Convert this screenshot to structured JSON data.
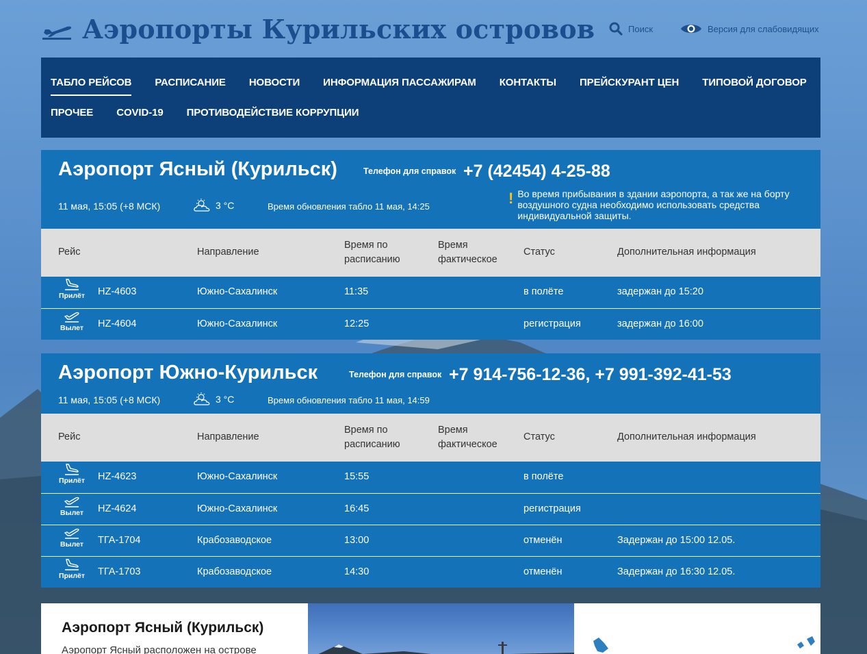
{
  "header": {
    "title": "Аэропорты Курильских островов",
    "search_label": "Поиск",
    "vision_label": "Версия для слабовидящих"
  },
  "nav": {
    "row1": [
      "ТАБЛО РЕЙСОВ",
      "РАСПИСАНИЕ",
      "НОВОСТИ",
      "ИНФОРМАЦИЯ ПАССАЖИРАМ",
      "КОНТАКТЫ",
      "ПРЕЙСКУРАНТ ЦЕН",
      "ТИПОВОЙ ДОГОВОР"
    ],
    "row2": [
      "ПРОЧЕЕ",
      "COVID-19",
      "ПРОТИВОДЕЙСТВИЕ КОРРУПЦИИ"
    ],
    "active": "ТАБЛО РЕЙСОВ"
  },
  "columns": {
    "flight": "Рейс",
    "direction": "Направление",
    "scheduled_1": "Время по",
    "scheduled_2": "расписанию",
    "actual_1": "Время",
    "actual_2": "фактическое",
    "status": "Статус",
    "info": "Дополнительная информация"
  },
  "airports": [
    {
      "name": "Аэропорт Ясный (Курильск)",
      "phone_label": "Телефон для справок",
      "phone": "+7 (42454) 4-25-88",
      "date": "11 мая, 15:05 (+8 МСК)",
      "temp": "3 °C",
      "updated": "Время обновления табло 11 мая, 14:25",
      "notice": "Во время прибывания в здании аэропорта, а так же на борту воздушного судна необходимо использовать средства индивидуальной защиты.",
      "flights": [
        {
          "type": "Прилёт",
          "kind": "arrival",
          "flight": "HZ-4603",
          "direction": "Южно-Сахалинск",
          "scheduled": "11:35",
          "actual": "",
          "status": "в полёте",
          "info": "задержан до 15:20"
        },
        {
          "type": "Вылет",
          "kind": "departure",
          "flight": "HZ-4604",
          "direction": "Южно-Сахалинск",
          "scheduled": "12:25",
          "actual": "",
          "status": "регистрация",
          "info": "задержан до 16:00"
        }
      ]
    },
    {
      "name": "Аэропорт Южно-Курильск",
      "phone_label": "Телефон для справок",
      "phone": "+7 914-756-12-36, +7 991-392-41-53",
      "date": "11 мая, 15:05 (+8 МСК)",
      "temp": "3 °C",
      "updated": "Время обновления табло 11 мая, 14:59",
      "flights": [
        {
          "type": "Прилёт",
          "kind": "arrival",
          "flight": "HZ-4623",
          "direction": "Южно-Сахалинск",
          "scheduled": "15:55",
          "actual": "",
          "status": "в полёте",
          "info": ""
        },
        {
          "type": "Вылет",
          "kind": "departure",
          "flight": "HZ-4624",
          "direction": "Южно-Сахалинск",
          "scheduled": "16:45",
          "actual": "",
          "status": "регистрация",
          "info": ""
        },
        {
          "type": "Вылет",
          "kind": "departure",
          "flight": "ТГА-1704",
          "direction": "Крабозаводское",
          "scheduled": "13:00",
          "actual": "",
          "status": "отменён",
          "info": "Задержан до 15:00 12.05."
        },
        {
          "type": "Прилёт",
          "kind": "arrival",
          "flight": "ТГА-1703",
          "direction": "Крабозаводское",
          "scheduled": "14:30",
          "actual": "",
          "status": "отменён",
          "info": "Задержан до 16:30 12.05."
        }
      ]
    }
  ],
  "card": {
    "title": "Аэропорт Ясный (Курильск)",
    "text": "Аэропорт Ясный расположен на острове"
  },
  "colors": {
    "nav_bg": "#0d4079",
    "board_blue": "#1372b8",
    "table_header": "#dedede",
    "title_blue": "#1a4f8f",
    "notice_yellow": "#f5c518"
  }
}
